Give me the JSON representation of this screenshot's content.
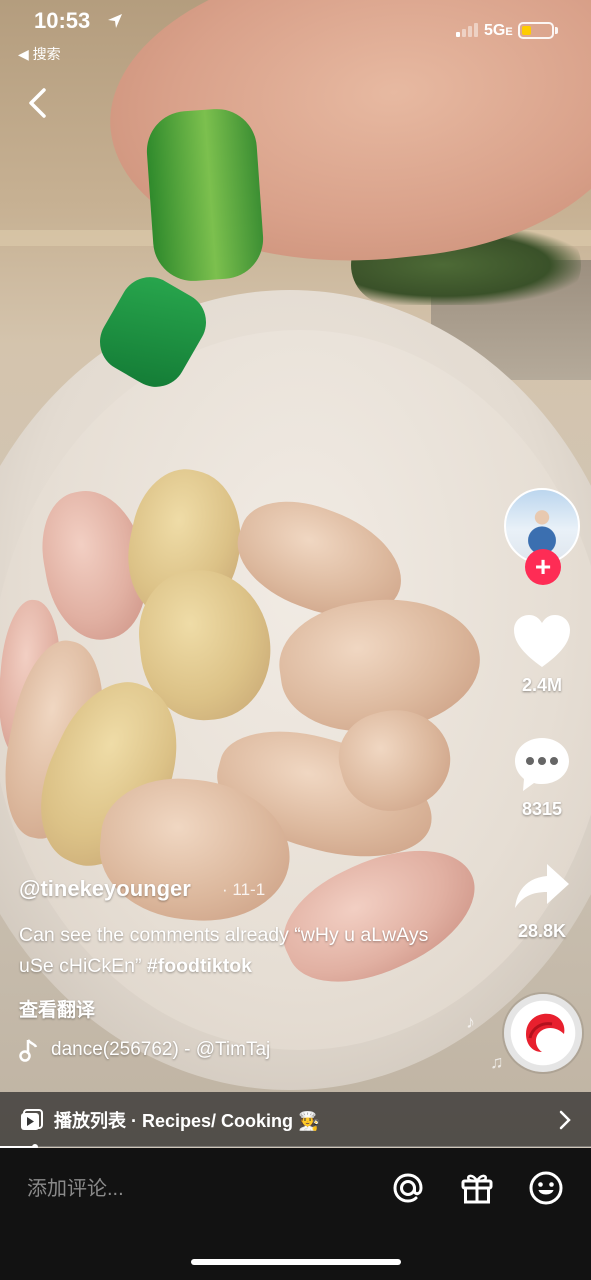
{
  "status_bar": {
    "time": "10:53",
    "back_app": "◀ 搜索",
    "network": "5G",
    "network_suffix": "E"
  },
  "video": {
    "author": "@tinekeyounger",
    "date": "· 11-1",
    "caption": "Can see the comments already “wHy u aLwAys uSe cHiCkEn”",
    "hashtag": "#foodtiktok",
    "translate_label": "查看翻译",
    "sound": "dance(256762) - @TimTaj"
  },
  "actions": {
    "likes": "2.4M",
    "comments": "8315",
    "shares": "28.8K"
  },
  "playlist": {
    "label": "播放列表 · Recipes/ Cooking 🧑‍🍳"
  },
  "progress": {
    "fraction": 0.06
  },
  "comment_bar": {
    "placeholder": "添加评论..."
  },
  "colors": {
    "follow": "#fe2c55",
    "battery": "#ffcc00",
    "bottom_bar": "#121212"
  }
}
